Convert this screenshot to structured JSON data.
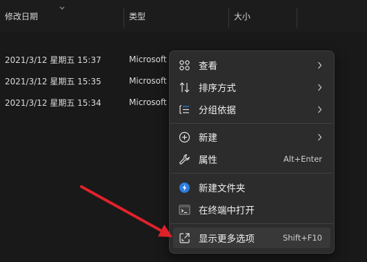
{
  "columns": {
    "date_modified": "修改日期",
    "type": "类型",
    "size": "大小"
  },
  "files": [
    {
      "date": "2021/3/12 星期五 15:37",
      "type": "Microsoft"
    },
    {
      "date": "2021/3/12 星期五 15:35",
      "type": "Microsoft"
    },
    {
      "date": "2021/3/12 星期五 15:34",
      "type": "Microsoft"
    }
  ],
  "context_menu": {
    "items": [
      {
        "label": "查看",
        "icon": "view-grid-icon",
        "submenu": true
      },
      {
        "label": "排序方式",
        "icon": "sort-icon",
        "submenu": true
      },
      {
        "label": "分组依据",
        "icon": "group-list-icon",
        "submenu": true
      },
      {
        "label": "新建",
        "icon": "new-plus-icon",
        "submenu": true
      },
      {
        "label": "属性",
        "icon": "wrench-icon",
        "accelerator": "Alt+Enter"
      },
      {
        "label": "新建文件夹",
        "icon": "new-folder-icon"
      },
      {
        "label": "在终端中打开",
        "icon": "terminal-icon"
      },
      {
        "label": "显示更多选项",
        "icon": "expand-icon",
        "accelerator": "Shift+F10"
      }
    ]
  },
  "colors": {
    "background": "#191919",
    "menu_background": "#2c2c2c",
    "hover": "#383838",
    "arrow": "#e0222a",
    "accent": "#2b7de0"
  }
}
